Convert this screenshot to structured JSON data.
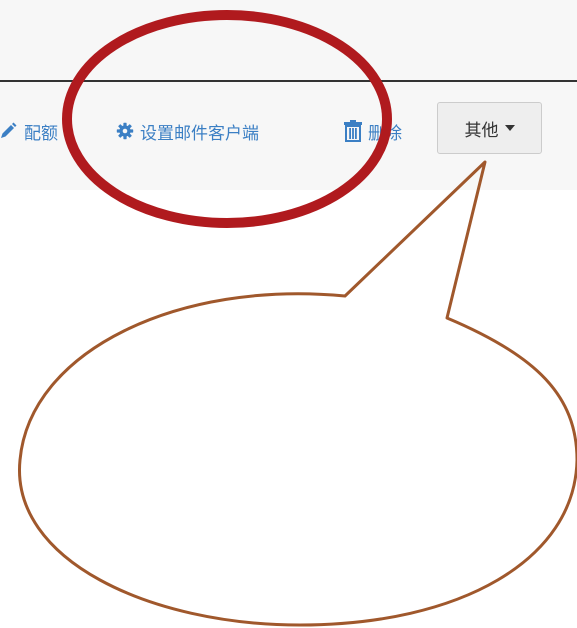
{
  "toolbar": {
    "quota_label": "配额",
    "client_label": "设置邮件客户端",
    "delete_label": "删除",
    "other_label": "其他"
  },
  "icons": {
    "quota": "pencil-icon",
    "client": "gear-icon",
    "delete": "trash-icon",
    "other": "caret-down-icon"
  },
  "colors": {
    "link": "#3b7fc4",
    "annotation_ellipse": "#b01a1e",
    "annotation_callout": "#a0582c"
  }
}
